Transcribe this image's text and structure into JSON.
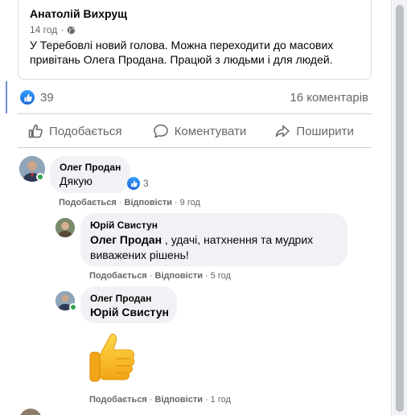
{
  "shared_post": {
    "author": "Анатолій Вихрущ",
    "time": "14 год",
    "text": "У Теребовлі новий голова. Можна переходити до масових привітань Олега Продана. Працюй з людьми і для людей.",
    "globe_icon": "globe-icon"
  },
  "post_stats": {
    "like_count": "39",
    "comment_count": "16 коментарів"
  },
  "actions": {
    "like": "Подобається",
    "comment": "Коментувати",
    "share": "Поширити"
  },
  "comments": [
    {
      "author": "Олег Продан",
      "text": "Дякую",
      "reaction_count": "3",
      "meta_like": "Подобається",
      "meta_reply": "Відповісти",
      "time": "9 год",
      "online": true
    },
    {
      "author": "Юрій Свистун",
      "mention": "Олег Продан",
      "text": " , удачі, натхнення та мудрих виважених рішень!",
      "meta_like": "Подобається",
      "meta_reply": "Відповісти",
      "time": "5 год"
    },
    {
      "author": "Олег Продан",
      "mention": "Юрій Свистун",
      "sticker": "thumbs-up-sticker",
      "meta_like": "Подобається",
      "meta_reply": "Відповісти",
      "time": "1 год",
      "online": true
    }
  ],
  "colors": {
    "like_blue": "#1877f2",
    "muted_text": "#65676b",
    "bubble": "#f0f2f5",
    "online_green": "#31a24c"
  }
}
